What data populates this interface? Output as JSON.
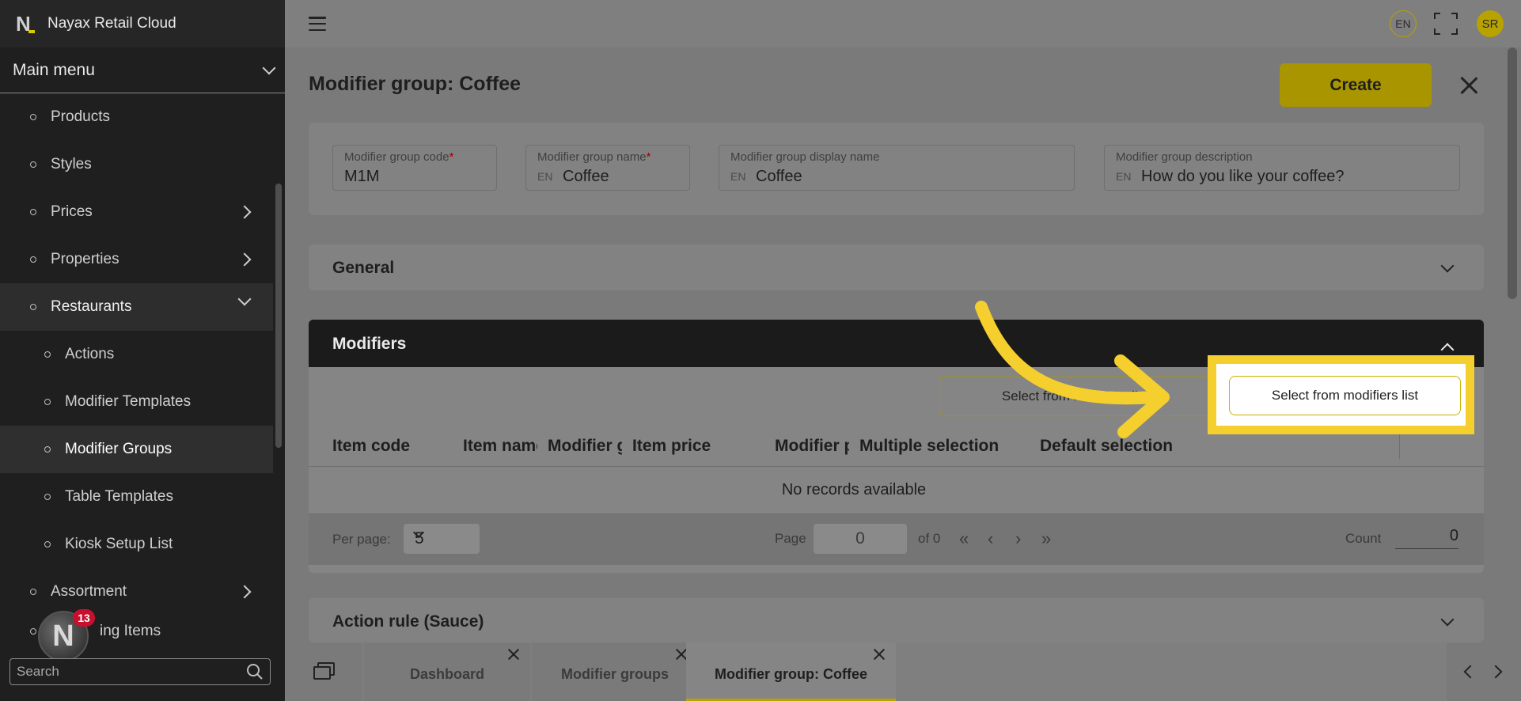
{
  "app": {
    "title": "Nayax Retail Cloud",
    "logo_letter": "N"
  },
  "sidebar": {
    "main_menu_label": "Main menu",
    "items": [
      {
        "label": "Products",
        "level": 1,
        "arrow": ""
      },
      {
        "label": "Styles",
        "level": 1,
        "arrow": ""
      },
      {
        "label": "Prices",
        "level": 1,
        "arrow": "right"
      },
      {
        "label": "Properties",
        "level": 1,
        "arrow": "right"
      },
      {
        "label": "Restaurants",
        "level": 1,
        "arrow": "down"
      },
      {
        "label": "Actions",
        "level": 2,
        "arrow": ""
      },
      {
        "label": "Modifier Templates",
        "level": 2,
        "arrow": ""
      },
      {
        "label": "Modifier Groups",
        "level": 2,
        "arrow": ""
      },
      {
        "label": "Table Templates",
        "level": 2,
        "arrow": ""
      },
      {
        "label": "Kiosk Setup List",
        "level": 2,
        "arrow": ""
      },
      {
        "label": "Assortment",
        "level": 1,
        "arrow": "right"
      },
      {
        "label": "ing Items",
        "level": 1,
        "arrow": ""
      }
    ],
    "notification_count": "13",
    "avatar_letter": "N",
    "search_placeholder": "Search"
  },
  "topbar": {
    "language": "EN",
    "user_initials": "SR"
  },
  "page": {
    "title": "Modifier group: Coffee",
    "create_label": "Create",
    "fields": {
      "code": {
        "label": "Modifier group code",
        "required": "*",
        "value": "M1M"
      },
      "name": {
        "label": "Modifier group name",
        "required": "*",
        "prefix": "EN",
        "value": "Coffee"
      },
      "display_name": {
        "label": "Modifier group display name",
        "prefix": "EN",
        "value": "Coffee"
      },
      "description": {
        "label": "Modifier group description",
        "prefix": "EN",
        "value": "How do you like your coffee?"
      }
    },
    "sections": {
      "general": "General",
      "modifiers": "Modifiers",
      "action_rule": "Action rule (Sauce)"
    },
    "modifiers": {
      "select_button_left": "Select from modifiers list",
      "select_button_right": "Select from modifiers list",
      "columns": [
        "Item code",
        "Item name",
        "Modifier group",
        "Item price",
        "Modifier price",
        "Multiple selection",
        "Default selection"
      ],
      "empty_text": "No records available",
      "pager": {
        "per_page_label": "Per page:",
        "per_page_value": "5",
        "page_label": "Page",
        "page_value": "0",
        "of_label": "of 0",
        "count_label": "Count",
        "count_value": "0"
      }
    }
  },
  "bottom_tabs": [
    {
      "label": "Dashboard",
      "active": false
    },
    {
      "label": "Modifier groups",
      "active": false
    },
    {
      "label": "Modifier group: Coffee",
      "active": true
    }
  ],
  "colors": {
    "accent": "#f5cf2e",
    "brand_yellow": "#b8a200",
    "dark": "#1b1b1b",
    "badge_red": "#c8102e"
  }
}
